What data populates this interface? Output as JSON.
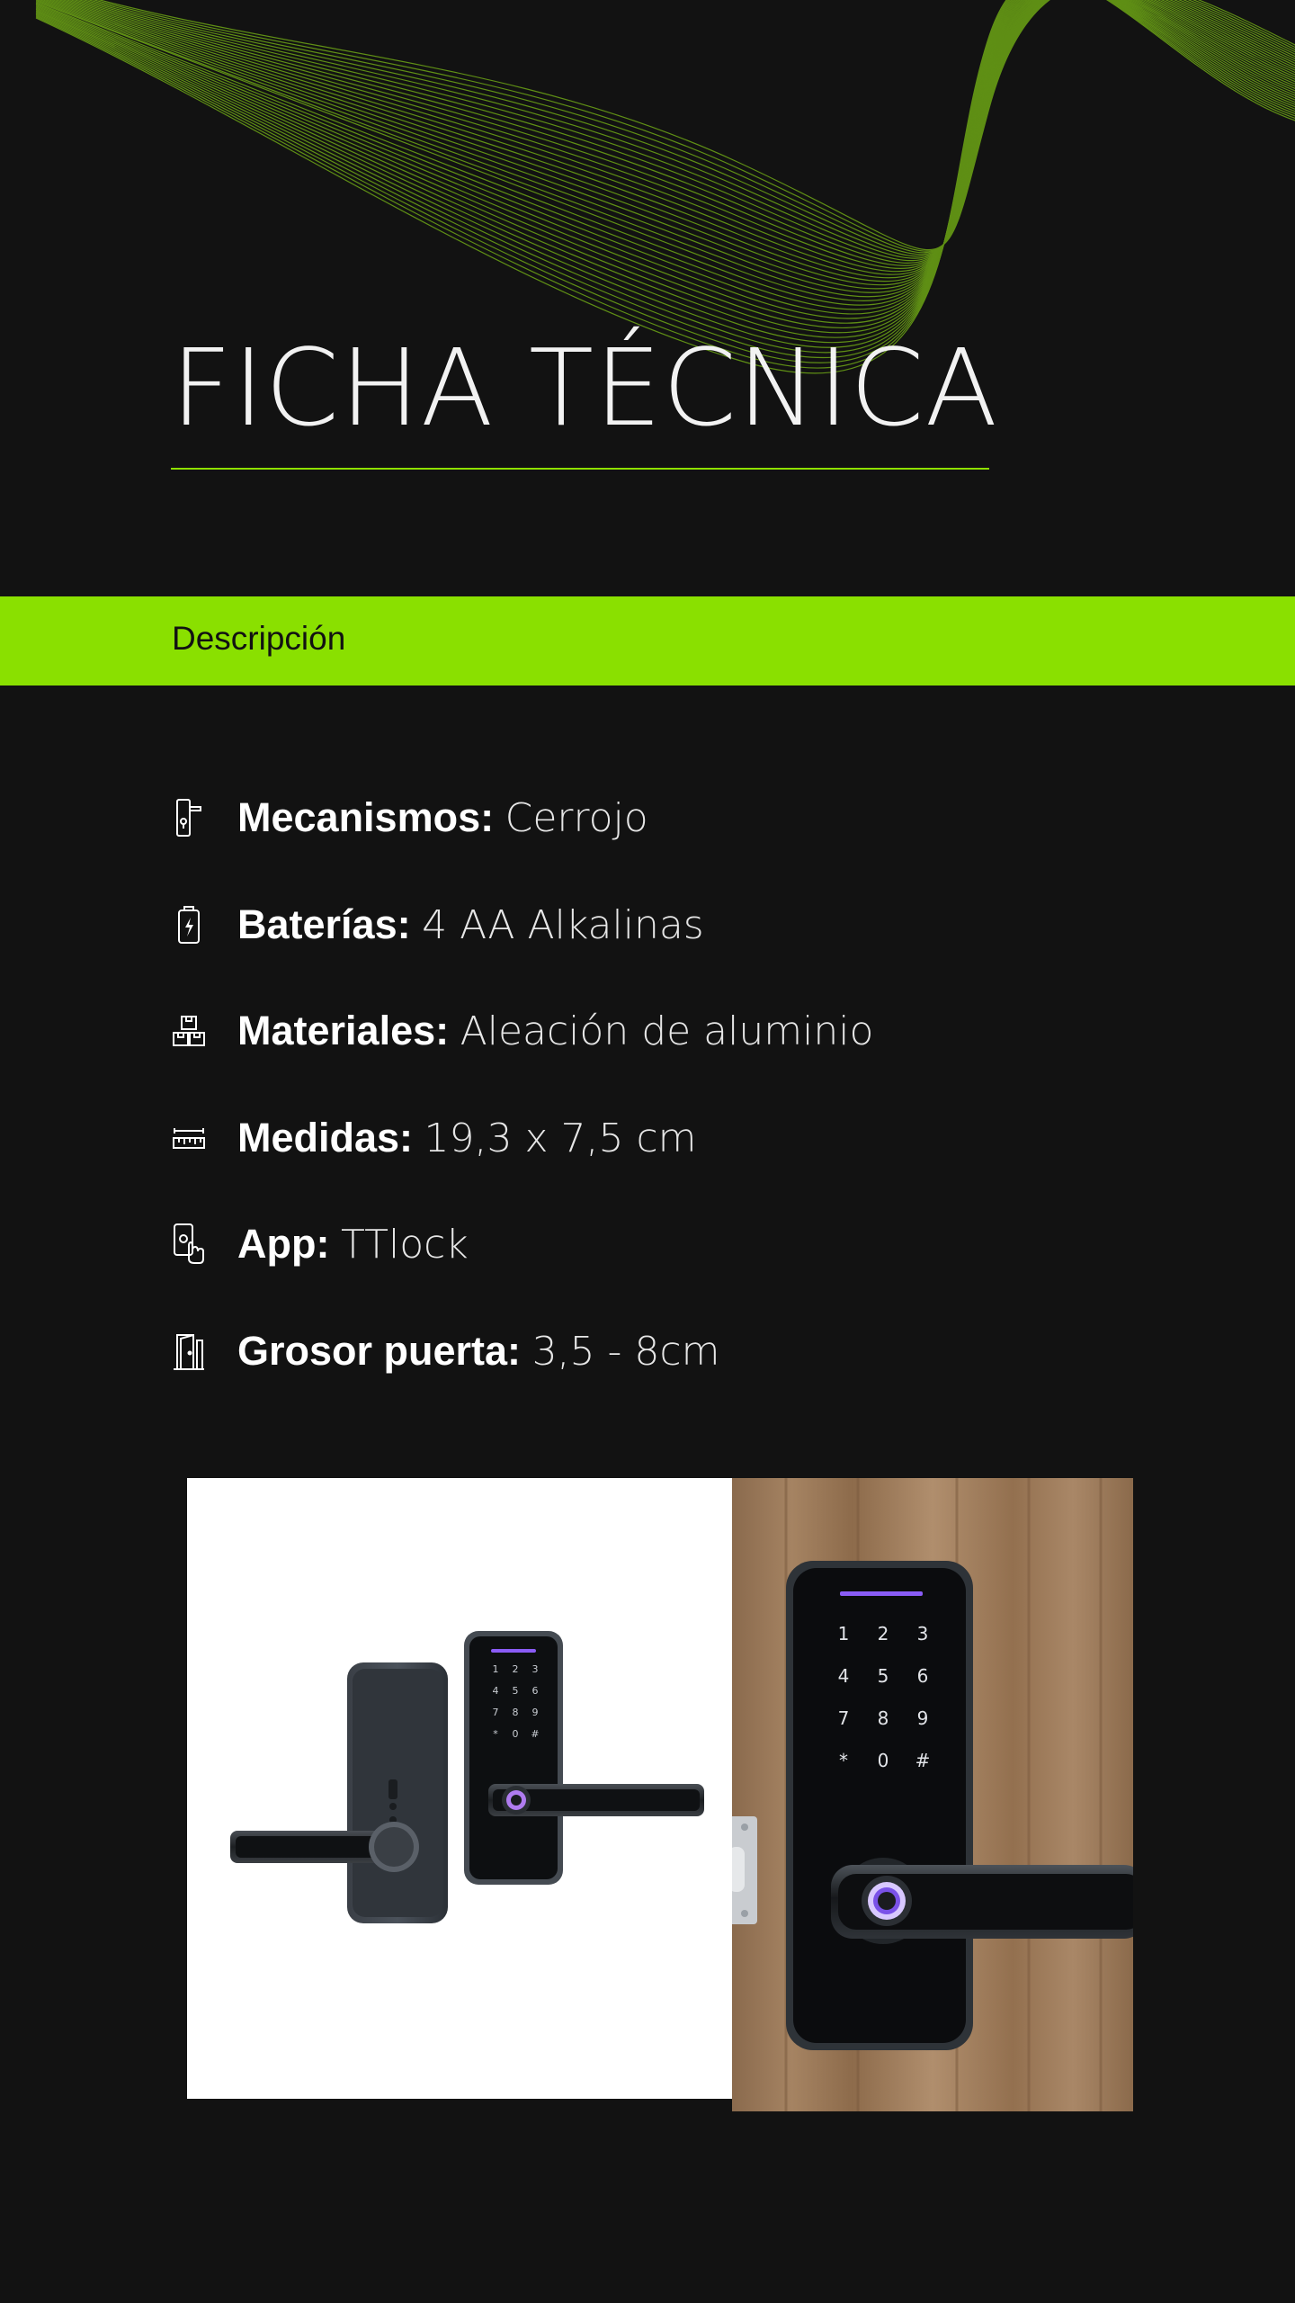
{
  "header": {
    "title": "FICHA TÉCNICA"
  },
  "section": {
    "label": "Descripción"
  },
  "specs": [
    {
      "icon": "door-handle-icon",
      "key": "Mecanismos:",
      "value": "Cerrojo"
    },
    {
      "icon": "battery-icon",
      "key": "Baterías:",
      "value": "4 AA Alkalinas"
    },
    {
      "icon": "materials-boxes-icon",
      "key": "Materiales:",
      "value": "Aleación de aluminio"
    },
    {
      "icon": "ruler-icon",
      "key": "Medidas:",
      "value": "19,3 x 7,5 cm"
    },
    {
      "icon": "phone-tap-icon",
      "key": "App:",
      "value": "TTlock"
    },
    {
      "icon": "door-icon",
      "key": "Grosor puerta:",
      "value": "3,5 - 8cm"
    }
  ],
  "keypad": {
    "keys": [
      "1",
      "2",
      "3",
      "4",
      "5",
      "6",
      "7",
      "8",
      "9",
      "*",
      "0",
      "#"
    ]
  },
  "colors": {
    "background": "#121212",
    "accent": "#8ae000",
    "text": "#ffffff"
  }
}
